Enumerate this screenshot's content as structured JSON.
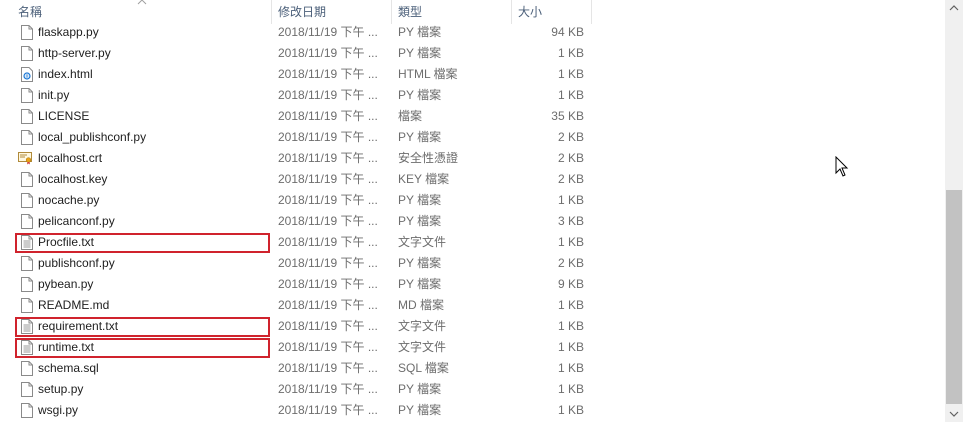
{
  "columns": {
    "name": "名稱",
    "date": "修改日期",
    "type": "類型",
    "size": "大小"
  },
  "files": [
    {
      "name": "flaskapp.py",
      "date": "2018/11/19 下午 ...",
      "type": "PY 檔案",
      "size": "94 KB",
      "icon": "file-icon"
    },
    {
      "name": "http-server.py",
      "date": "2018/11/19 下午 ...",
      "type": "PY 檔案",
      "size": "1 KB",
      "icon": "file-icon"
    },
    {
      "name": "index.html",
      "date": "2018/11/19 下午 ...",
      "type": "HTML 檔案",
      "size": "1 KB",
      "icon": "html-file-icon"
    },
    {
      "name": "init.py",
      "date": "2018/11/19 下午 ...",
      "type": "PY 檔案",
      "size": "1 KB",
      "icon": "file-icon"
    },
    {
      "name": "LICENSE",
      "date": "2018/11/19 下午 ...",
      "type": "檔案",
      "size": "35 KB",
      "icon": "file-icon"
    },
    {
      "name": "local_publishconf.py",
      "date": "2018/11/19 下午 ...",
      "type": "PY 檔案",
      "size": "2 KB",
      "icon": "file-icon"
    },
    {
      "name": "localhost.crt",
      "date": "2018/11/19 下午 ...",
      "type": "安全性憑證",
      "size": "2 KB",
      "icon": "certificate-icon"
    },
    {
      "name": "localhost.key",
      "date": "2018/11/19 下午 ...",
      "type": "KEY 檔案",
      "size": "2 KB",
      "icon": "file-icon"
    },
    {
      "name": "nocache.py",
      "date": "2018/11/19 下午 ...",
      "type": "PY 檔案",
      "size": "1 KB",
      "icon": "file-icon"
    },
    {
      "name": "pelicanconf.py",
      "date": "2018/11/19 下午 ...",
      "type": "PY 檔案",
      "size": "3 KB",
      "icon": "file-icon"
    },
    {
      "name": "Procfile.txt",
      "date": "2018/11/19 下午 ...",
      "type": "文字文件",
      "size": "1 KB",
      "icon": "text-file-icon",
      "highlighted": true
    },
    {
      "name": "publishconf.py",
      "date": "2018/11/19 下午 ...",
      "type": "PY 檔案",
      "size": "2 KB",
      "icon": "file-icon"
    },
    {
      "name": "pybean.py",
      "date": "2018/11/19 下午 ...",
      "type": "PY 檔案",
      "size": "9 KB",
      "icon": "file-icon"
    },
    {
      "name": "README.md",
      "date": "2018/11/19 下午 ...",
      "type": "MD 檔案",
      "size": "1 KB",
      "icon": "file-icon"
    },
    {
      "name": "requirement.txt",
      "date": "2018/11/19 下午 ...",
      "type": "文字文件",
      "size": "1 KB",
      "icon": "text-file-icon",
      "highlighted": true
    },
    {
      "name": "runtime.txt",
      "date": "2018/11/19 下午 ...",
      "type": "文字文件",
      "size": "1 KB",
      "icon": "text-file-icon",
      "highlighted": true
    },
    {
      "name": "schema.sql",
      "date": "2018/11/19 下午 ...",
      "type": "SQL 檔案",
      "size": "1 KB",
      "icon": "file-icon"
    },
    {
      "name": "setup.py",
      "date": "2018/11/19 下午 ...",
      "type": "PY 檔案",
      "size": "1 KB",
      "icon": "file-icon"
    },
    {
      "name": "wsgi.py",
      "date": "2018/11/19 下午 ...",
      "type": "PY 檔案",
      "size": "1 KB",
      "icon": "file-icon"
    }
  ],
  "colors": {
    "highlight_border": "#d0232d",
    "header_text": "#4c607a",
    "secondary_text": "#6d6d6d"
  }
}
